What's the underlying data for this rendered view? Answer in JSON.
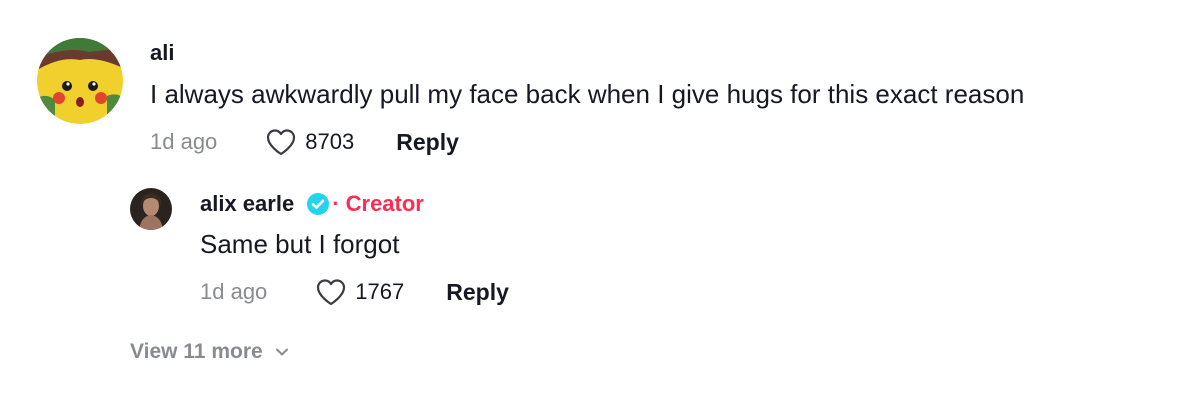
{
  "comment": {
    "username": "ali",
    "avatar_icon": "surprised-pikachu-avatar",
    "text": "I always awkwardly pull my face back when I give hugs for this exact reason",
    "timestamp": "1d ago",
    "likes": "8703",
    "reply_label": "Reply"
  },
  "reply": {
    "username": "alix earle",
    "verified_icon": "verified-badge-icon",
    "creator_label": "· Creator",
    "text": "Same but I forgot",
    "timestamp": "1d ago",
    "likes": "1767",
    "reply_label": "Reply"
  },
  "view_more": {
    "label": "View 11 more",
    "icon": "chevron-down-icon"
  },
  "colors": {
    "text_primary": "#161823",
    "text_secondary": "#8a8b91",
    "creator_accent": "#fe2c55",
    "verified": "#20d5ec"
  }
}
